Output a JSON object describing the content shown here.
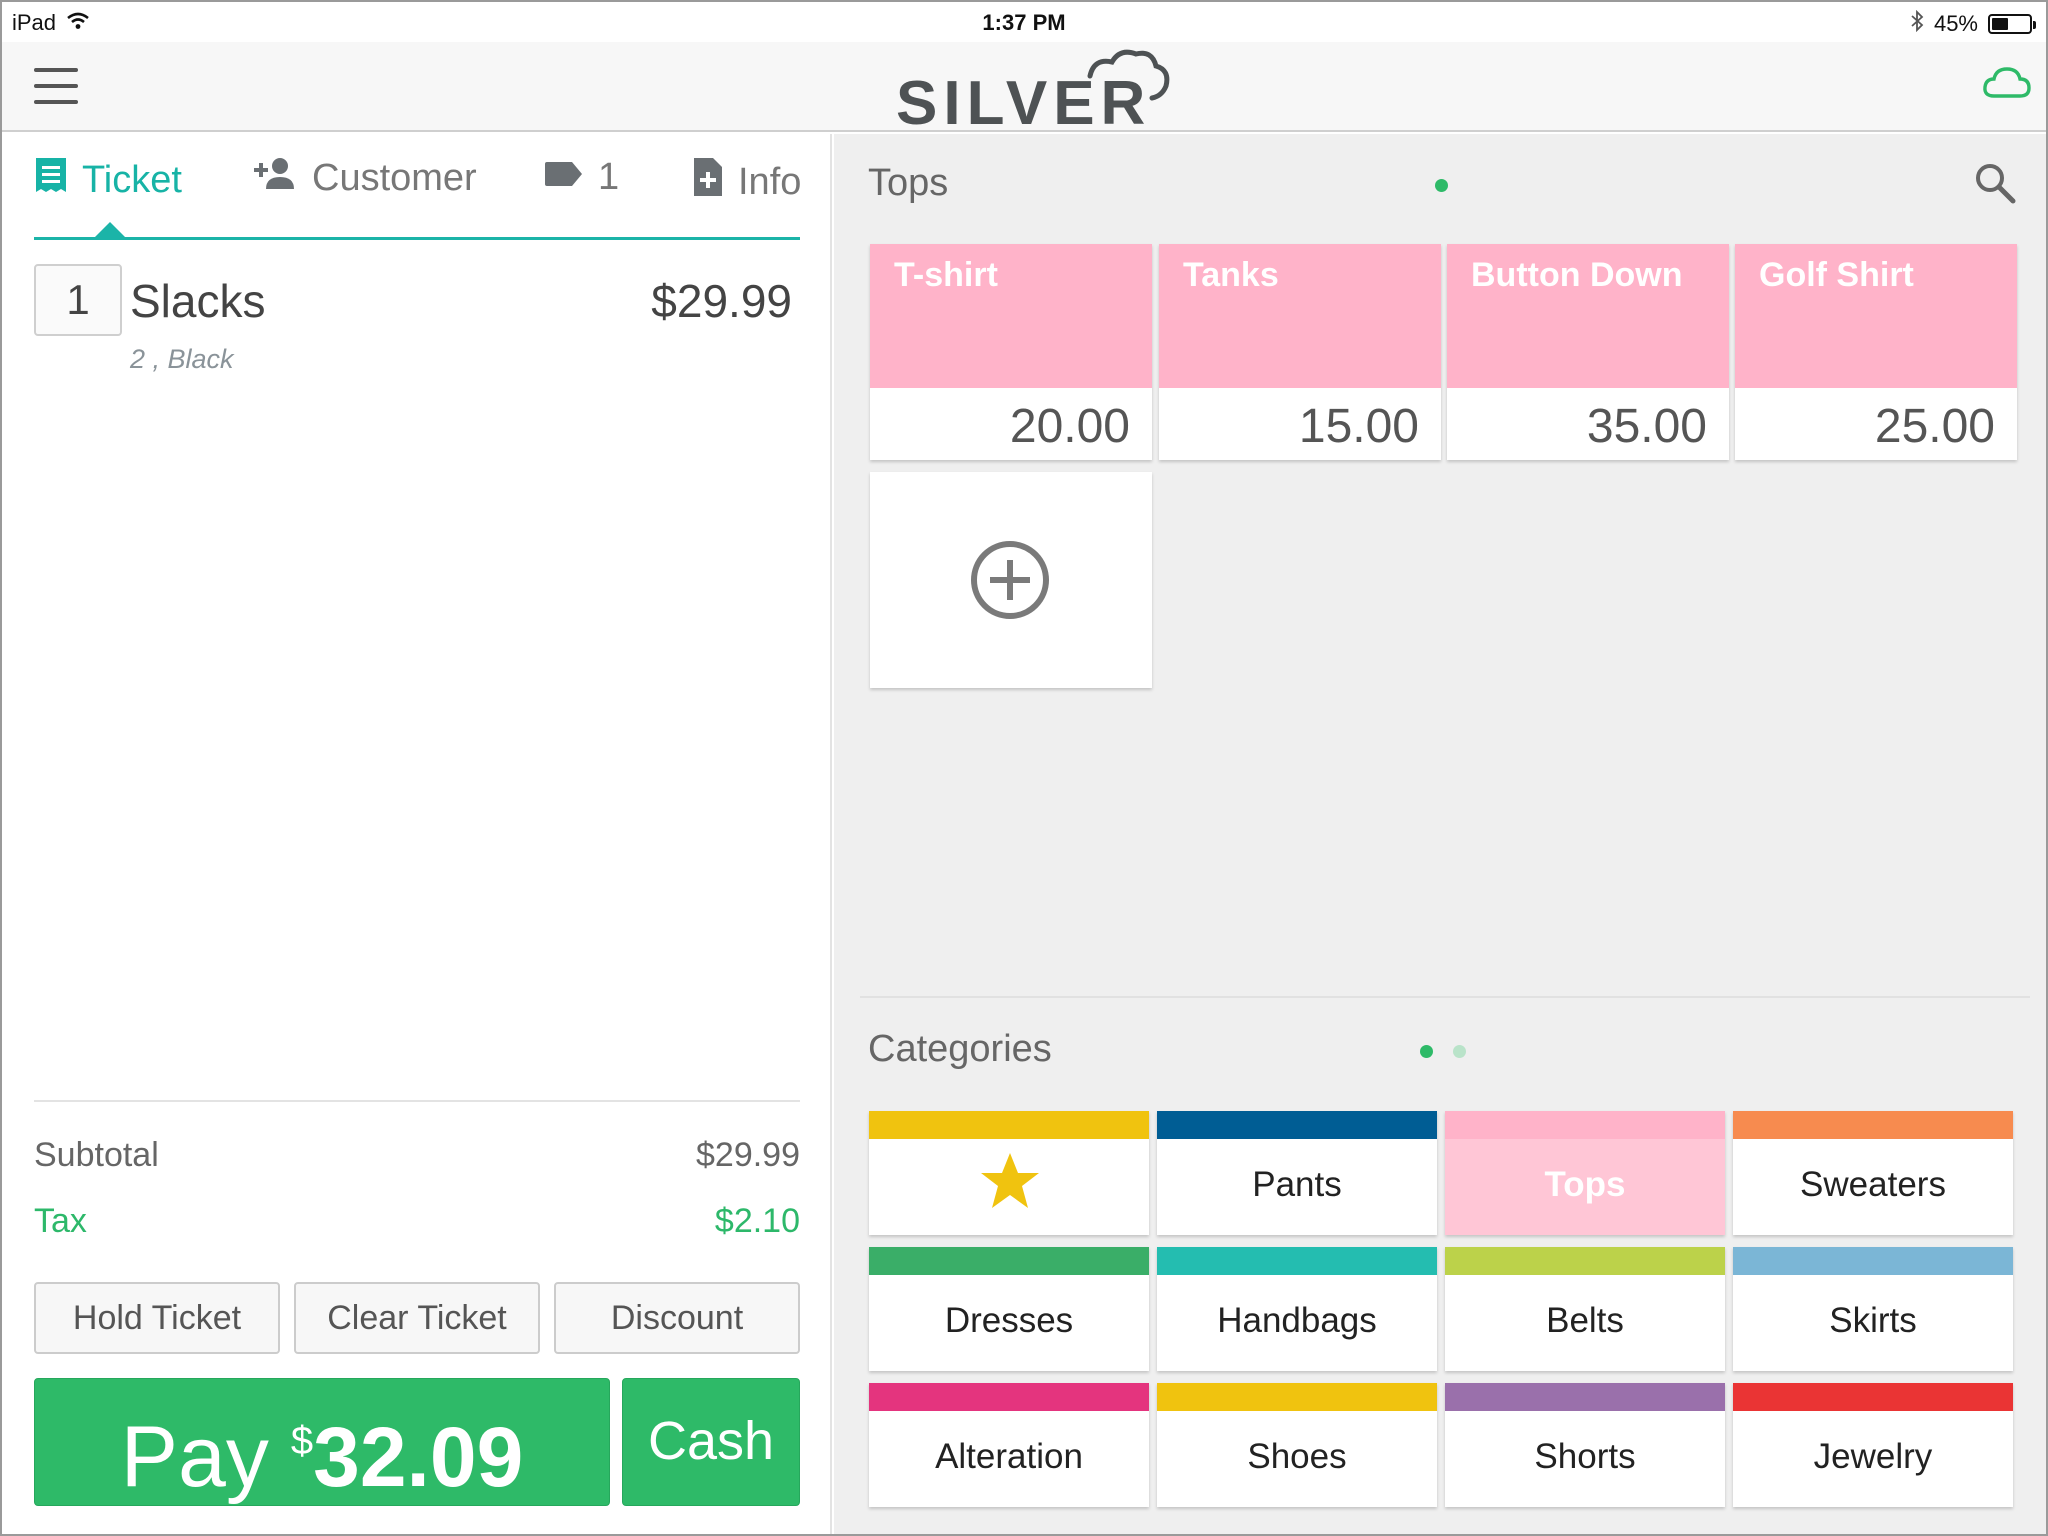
{
  "status_bar": {
    "device": "iPad",
    "time": "1:37 PM",
    "battery": "45%",
    "battery_level": 0.45
  },
  "header": {
    "logo_text": "SILVER",
    "icons": [
      "menu-icon",
      "cloud-icon"
    ]
  },
  "ticket_tabs": [
    {
      "label": "Ticket",
      "icon": "receipt-icon",
      "active": true
    },
    {
      "label": "Customer",
      "icon": "add-person-icon",
      "active": false
    },
    {
      "label": "1",
      "icon": "tag-icon",
      "active": false
    },
    {
      "label": "Info",
      "icon": "add-document-icon",
      "active": false
    }
  ],
  "ticket": {
    "items": [
      {
        "qty": "1",
        "name": "Slacks",
        "price": "$29.99",
        "variant": "2 , Black"
      }
    ],
    "subtotal_label": "Subtotal",
    "subtotal_value": "$29.99",
    "tax_label": "Tax",
    "tax_value": "$2.10"
  },
  "actions": {
    "hold": "Hold Ticket",
    "clear": "Clear Ticket",
    "discount": "Discount",
    "pay_label": "Pay",
    "pay_currency": "$",
    "pay_amount": "32.09",
    "cash": "Cash"
  },
  "products": {
    "title": "Tops",
    "items": [
      {
        "name": "T-shirt",
        "price": "20.00"
      },
      {
        "name": "Tanks",
        "price": "15.00"
      },
      {
        "name": "Button Down",
        "price": "35.00"
      },
      {
        "name": "Golf Shirt",
        "price": "25.00"
      }
    ],
    "tile_color": "#ffb3c9"
  },
  "categories": {
    "title": "Categories",
    "items": [
      {
        "name": "",
        "color": "#f0c30f",
        "icon": "star-icon"
      },
      {
        "name": "Pants",
        "color": "#005d94"
      },
      {
        "name": "Tops",
        "color": "#ffb3c9",
        "selected": true
      },
      {
        "name": "Sweaters",
        "color": "#f78b4f"
      },
      {
        "name": "Dresses",
        "color": "#3aae68"
      },
      {
        "name": "Handbags",
        "color": "#24bdb0"
      },
      {
        "name": "Belts",
        "color": "#bcd24a"
      },
      {
        "name": "Skirts",
        "color": "#7bb6d6"
      },
      {
        "name": "Alteration",
        "color": "#e4347e"
      },
      {
        "name": "Shoes",
        "color": "#f0c30f"
      },
      {
        "name": "Shorts",
        "color": "#9a70ab"
      },
      {
        "name": "Jewelry",
        "color": "#ea3434"
      }
    ]
  },
  "colors": {
    "accent": "#17b3a6",
    "pay_green": "#2eba68",
    "tax_green": "#2db86a"
  }
}
